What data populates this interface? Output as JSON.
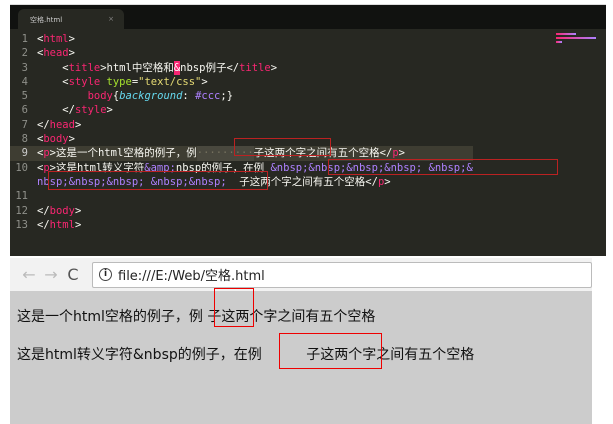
{
  "editor": {
    "tab_title": "空格.html",
    "tab_close": "×",
    "lines": [
      {
        "n": "1",
        "t": [
          [
            "",
            "<"
          ],
          [
            "tag",
            "html"
          ],
          [
            "",
            ">"
          ]
        ]
      },
      {
        "n": "2",
        "t": [
          [
            "",
            "<"
          ],
          [
            "tag",
            "head"
          ],
          [
            "",
            ">"
          ]
        ]
      },
      {
        "n": "3",
        "t": [
          [
            "",
            "    <"
          ],
          [
            "tag",
            "title"
          ],
          [
            "",
            ">html中空格和"
          ],
          [
            "hl",
            "&"
          ],
          [
            "",
            "nbsp例子</"
          ],
          [
            "tag",
            "title"
          ],
          [
            "",
            ">"
          ]
        ]
      },
      {
        "n": "4",
        "t": [
          [
            "",
            "    <"
          ],
          [
            "tag",
            "style"
          ],
          [
            "attr",
            " type"
          ],
          [
            "",
            "="
          ],
          [
            "str",
            "\"text/css\""
          ],
          [
            "",
            ">"
          ]
        ]
      },
      {
        "n": "5",
        "t": [
          [
            "",
            "        "
          ],
          [
            "tag",
            "body"
          ],
          [
            "",
            "{"
          ],
          [
            "prop",
            "background"
          ],
          [
            "",
            ": "
          ],
          [
            "ent",
            "#ccc"
          ],
          [
            "",
            ";}"
          ]
        ]
      },
      {
        "n": "6",
        "t": [
          [
            "",
            "    </"
          ],
          [
            "tag",
            "style"
          ],
          [
            "",
            ">"
          ]
        ]
      },
      {
        "n": "7",
        "t": [
          [
            "",
            "</"
          ],
          [
            "tag",
            "head"
          ],
          [
            "",
            ">"
          ]
        ]
      },
      {
        "n": "8",
        "t": [
          [
            "",
            "<"
          ],
          [
            "tag",
            "body"
          ],
          [
            "",
            ">"
          ]
        ]
      },
      {
        "n": "9",
        "cur": true,
        "t": [
          [
            "",
            "<"
          ],
          [
            "tag",
            "p"
          ],
          [
            "",
            ">这是一个html空格的例子，例"
          ],
          [
            "ws",
            "·········"
          ],
          [
            "",
            "子这两个字之间有五个空格</"
          ],
          [
            "tag",
            "p"
          ],
          [
            "",
            ">"
          ]
        ]
      },
      {
        "n": "10",
        "t": [
          [
            "",
            "<"
          ],
          [
            "tag",
            "p"
          ],
          [
            "",
            ">这是html转义字符"
          ],
          [
            "ent",
            "&amp;"
          ],
          [
            "",
            "nbsp的例子，在例 "
          ],
          [
            "ent",
            "&nbsp;&nbsp;&nbsp;&nbsp; &nbsp;&"
          ]
        ]
      },
      {
        "n": "",
        "t": [
          [
            "ent",
            "nbsp;&nbsp;&nbsp; &nbsp;&nbsp;"
          ],
          [
            "",
            "  子这两个字之间有五个空格</"
          ],
          [
            "tag",
            "p"
          ],
          [
            "",
            ">"
          ]
        ]
      },
      {
        "n": "11",
        "t": []
      },
      {
        "n": "12",
        "t": [
          [
            "",
            "</"
          ],
          [
            "tag",
            "body"
          ],
          [
            "",
            ">"
          ]
        ]
      },
      {
        "n": "13",
        "t": [
          [
            "",
            "</"
          ],
          [
            "tag",
            "html"
          ],
          [
            "",
            ">"
          ]
        ]
      }
    ]
  },
  "browser": {
    "back": "←",
    "forward": "→",
    "reload": "C",
    "info": "i",
    "url": "file:///E:/Web/空格.html",
    "para1": "这是一个html空格的例子，例 子这两个字之间有五个空格",
    "para2": "这是html转义字符&nbsp的例子，在例          子这两个字之间有五个空格"
  }
}
